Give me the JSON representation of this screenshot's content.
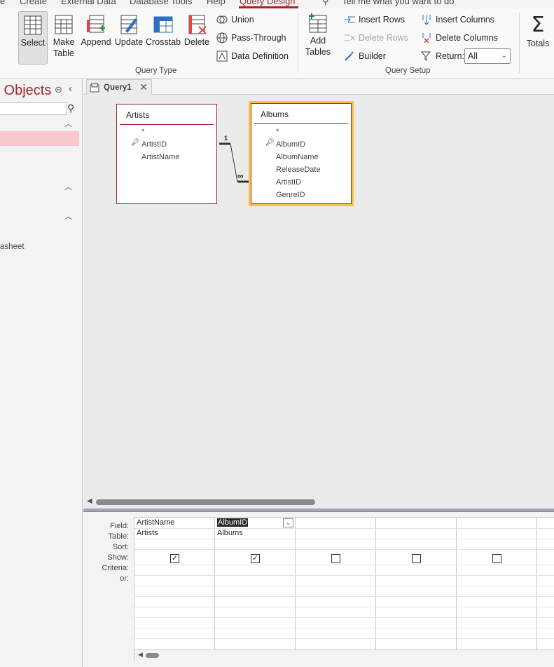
{
  "menu": {
    "items": [
      "e",
      "Create",
      "External Data",
      "Database Tools",
      "Help",
      "Query Design",
      "Tell me what you want to do"
    ],
    "active": "Query Design"
  },
  "ribbon": {
    "query_type": {
      "buttons": [
        {
          "label": "Select",
          "icon": "select-query-icon"
        },
        {
          "label": "Make\nTable",
          "icon": "make-table-icon"
        },
        {
          "label": "Append",
          "icon": "append-icon"
        },
        {
          "label": "Update",
          "icon": "update-icon"
        },
        {
          "label": "Crosstab",
          "icon": "crosstab-icon"
        },
        {
          "label": "Delete",
          "icon": "delete-query-icon"
        }
      ],
      "small": [
        "Union",
        "Pass-Through",
        "Data Definition"
      ],
      "group_label": "Query Type"
    },
    "query_setup": {
      "add_tables": "Add\nTables",
      "small_left": [
        "Insert Rows",
        "Delete Rows",
        "Builder"
      ],
      "small_right": [
        "Insert Columns",
        "Delete Columns"
      ],
      "return_label": "Return:",
      "return_value": "All",
      "group_label": "Query Setup"
    },
    "totals": "Totals",
    "selected_button": "Select",
    "disabled_buttons": [
      "Delete Rows"
    ]
  },
  "nav": {
    "title": "s Objects",
    "partial_item": "asheet"
  },
  "tabs": [
    {
      "label": "Query1"
    }
  ],
  "tables": [
    {
      "name": "Artists",
      "star": "*",
      "fields": [
        {
          "name": "ArtistID",
          "key": true
        },
        {
          "name": "ArtistName",
          "key": false
        }
      ]
    },
    {
      "name": "Albums",
      "star": "*",
      "fields": [
        {
          "name": "AlbumID",
          "key": true
        },
        {
          "name": "AlbumName",
          "key": false
        },
        {
          "name": "ReleaseDate",
          "key": false
        },
        {
          "name": "ArtistID",
          "key": false
        },
        {
          "name": "GenreID",
          "key": false
        }
      ]
    }
  ],
  "relationship": {
    "one": "1",
    "many": "∞"
  },
  "qbe": {
    "row_labels": [
      "Field:",
      "Table:",
      "Sort:",
      "Show:",
      "Criteria:",
      "or:"
    ],
    "columns": [
      {
        "field": "ArtistName",
        "table": "Artists",
        "show": true
      },
      {
        "field": "AlbumID",
        "table": "Albums",
        "show": true,
        "selected": true
      },
      {
        "field": "",
        "table": "",
        "show": false
      },
      {
        "field": "",
        "table": "",
        "show": false
      },
      {
        "field": "",
        "table": "",
        "show": false
      }
    ]
  },
  "colors": {
    "accent": "#a4262c",
    "highlight": "#f6c342",
    "nav_selected": "#f8c8cc"
  }
}
